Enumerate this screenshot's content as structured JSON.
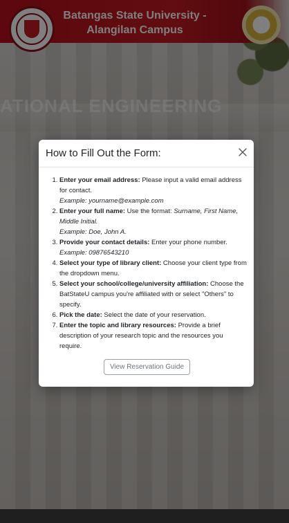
{
  "header": {
    "title": "Batangas State University - Alangilan Campus",
    "background_text": "ATIONAL ENGINEERING",
    "brand_color": "#c41a22"
  },
  "modal": {
    "title": "How to Fill Out the Form:",
    "close_icon": "close-icon",
    "steps": [
      {
        "label": "Enter your email address:",
        "text": " Please input a valid email address for contact.",
        "example": "Example: yourname@example.com"
      },
      {
        "label": "Enter your full name:",
        "text": " Use the format: ",
        "format": "Surname, First Name, Middle Initial.",
        "example": "Example: Doe, John A."
      },
      {
        "label": "Provide your contact details:",
        "text": " Enter your phone number.",
        "example": "Example: 09876543210"
      },
      {
        "label": "Select your type of library client:",
        "text": " Choose your client type from the dropdown menu."
      },
      {
        "label": "Select your school/college/university affiliation:",
        "text": " Choose the BatStateU campus you're affiliated with or select \"Others\" to specify."
      },
      {
        "label": "Pick the date:",
        "text": " Select the date of your reservation."
      },
      {
        "label": "Enter the topic and library resources:",
        "text": " Provide a brief description of your research topic and the resources you require."
      }
    ],
    "guide_button_label": "View Reservation Guide"
  }
}
